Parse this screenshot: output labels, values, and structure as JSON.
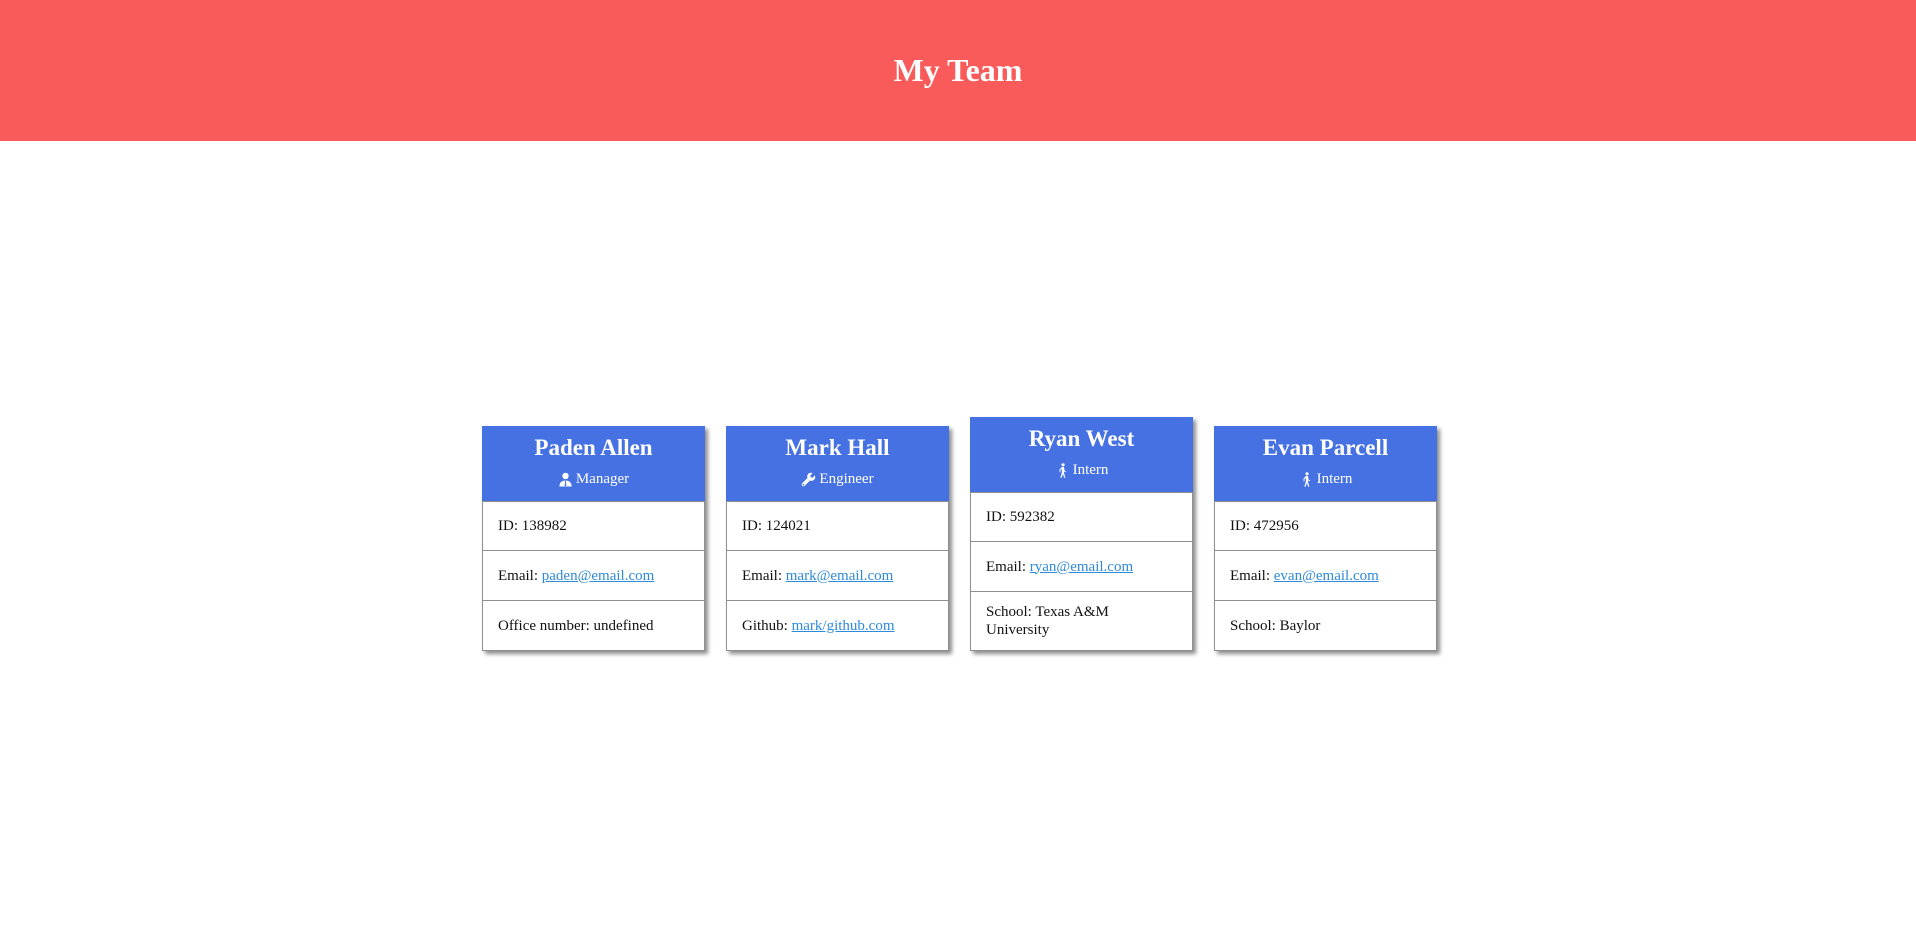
{
  "header": {
    "title": "My Team"
  },
  "colors": {
    "header_bg": "#f95a5a",
    "card_head_bg": "#4671e3",
    "link": "#2f8ad8"
  },
  "cards": [
    {
      "name": "Paden Allen",
      "role": "Manager",
      "role_icon": "user-tie-icon",
      "id_label": "ID: ",
      "id": "138982",
      "email_label": "Email: ",
      "email": "paden@email.com",
      "extra_label": "Office number: ",
      "extra": "undefined"
    },
    {
      "name": "Mark Hall",
      "role": "Engineer",
      "role_icon": "wrench-icon",
      "id_label": "ID: ",
      "id": "124021",
      "email_label": "Email: ",
      "email": "mark@email.com",
      "extra_label": "Github: ",
      "extra": "mark/github.com"
    },
    {
      "name": "Ryan West",
      "role": "Intern",
      "role_icon": "walking-person-icon",
      "id_label": "ID: ",
      "id": "592382",
      "email_label": "Email: ",
      "email": "ryan@email.com",
      "extra_label": "School: ",
      "extra": "Texas A&M University"
    },
    {
      "name": "Evan Parcell",
      "role": "Intern",
      "role_icon": "walking-person-icon",
      "id_label": "ID: ",
      "id": "472956",
      "email_label": "Email: ",
      "email": "evan@email.com",
      "extra_label": "School: ",
      "extra": "Baylor"
    }
  ]
}
